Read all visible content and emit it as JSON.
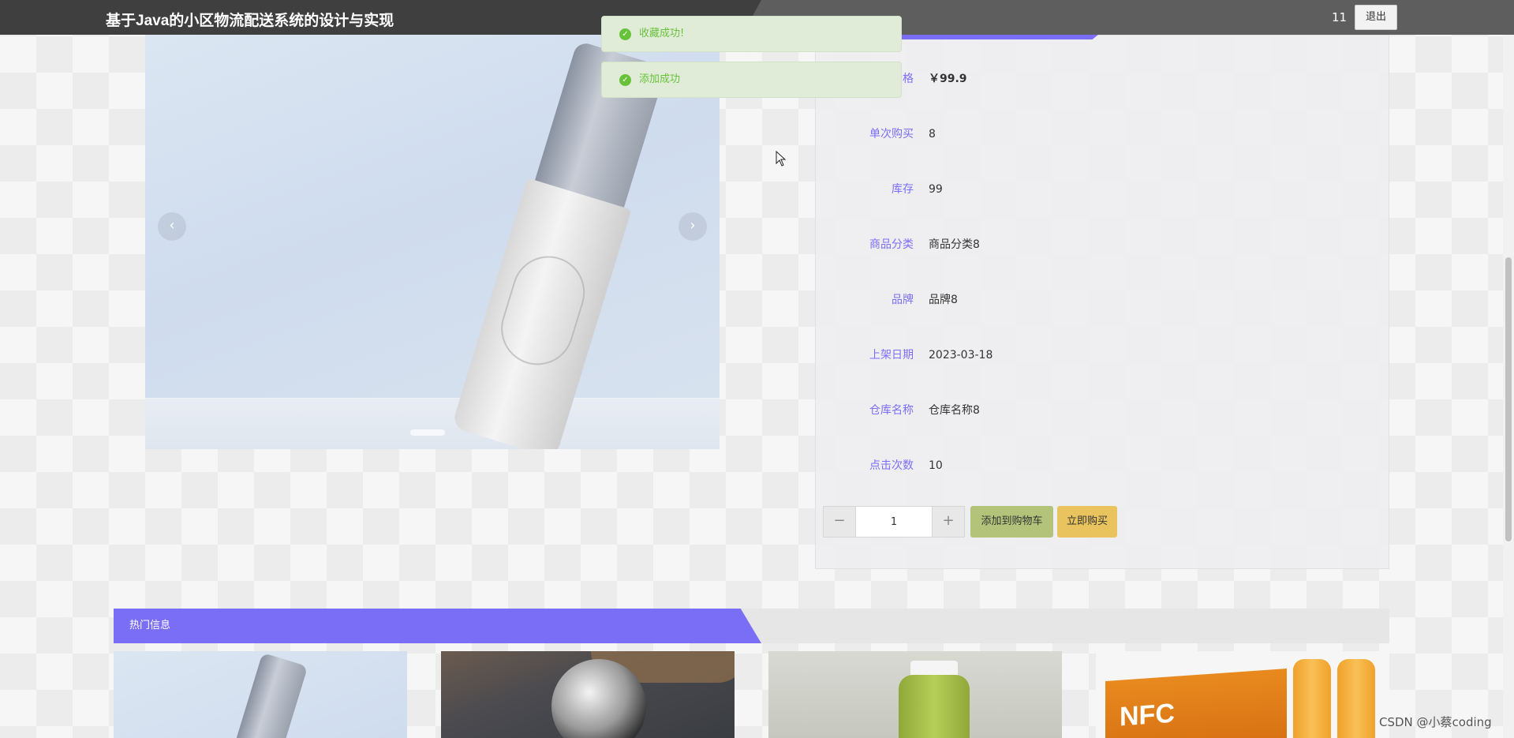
{
  "header": {
    "site_title": "基于Java的小区物流配送系统的设计与实现",
    "user_count": "11",
    "logout_label": "退出"
  },
  "toasts": [
    {
      "text": "收藏成功!"
    },
    {
      "text": "添加成功"
    }
  ],
  "gallery": {
    "prev_icon": "‹",
    "next_icon": "›"
  },
  "product": {
    "fields": [
      {
        "label": "价格",
        "value": "￥99.9"
      },
      {
        "label": "单次购买",
        "value": "8"
      },
      {
        "label": "库存",
        "value": "99"
      },
      {
        "label": "商品分类",
        "value": "商品分类8"
      },
      {
        "label": "品牌",
        "value": "品牌8"
      },
      {
        "label": "上架日期",
        "value": "2023-03-18"
      },
      {
        "label": "仓库名称",
        "value": "仓库名称8"
      },
      {
        "label": "点击次数",
        "value": "10"
      }
    ],
    "quantity": "1",
    "minus_icon": "−",
    "plus_icon": "+",
    "add_to_cart_label": "添加到购物车",
    "buy_now_label": "立即购买"
  },
  "hot": {
    "title": "热门信息",
    "box_text": "NFC"
  },
  "watermark": "CSDN @小蔡coding",
  "colors": {
    "accent": "#7b6ef6",
    "success": "#67c23a",
    "cart_button": "#b3c47a",
    "buy_button": "#e8c35e"
  }
}
